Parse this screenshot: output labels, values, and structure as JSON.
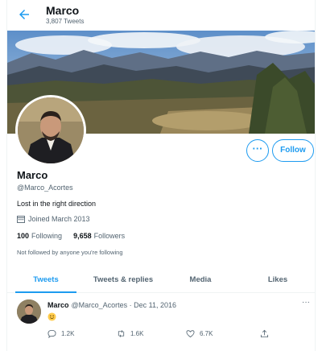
{
  "header": {
    "name": "Marco",
    "tweet_count": "3,807 Tweets"
  },
  "profile": {
    "more_label": "···",
    "follow_label": "Follow",
    "name": "Marco",
    "handle": "@Marco_Acortes",
    "bio": "Lost in the right direction",
    "joined": "Joined March 2013",
    "following_count": "100",
    "following_label": "Following",
    "followers_count": "9,658",
    "followers_label": "Followers",
    "follow_note": "Not followed by anyone you're following"
  },
  "tabs": [
    {
      "label": "Tweets",
      "active": true
    },
    {
      "label": "Tweets & replies",
      "active": false
    },
    {
      "label": "Media",
      "active": false
    },
    {
      "label": "Likes",
      "active": false
    }
  ],
  "tweet": {
    "name": "Marco",
    "handle_date": "@Marco_Acortes · Dec 11, 2016",
    "more_label": "···",
    "content_icon": "smiley-emoji-icon",
    "replies": "1.2K",
    "retweets": "1.6K",
    "likes": "6.7K"
  },
  "colors": {
    "accent": "#1d9bf0",
    "text": "#0f1419",
    "secondary_text": "#536471"
  }
}
